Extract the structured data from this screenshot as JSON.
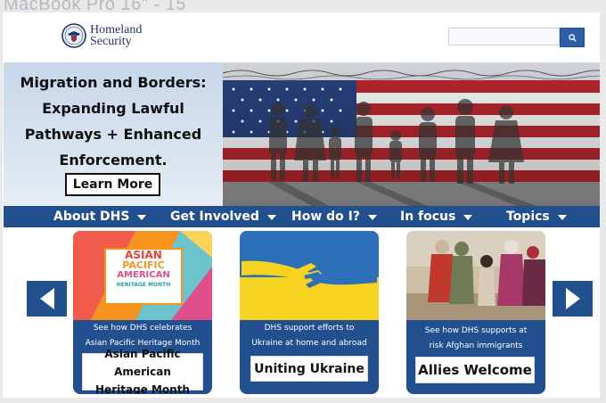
{
  "device": {
    "label": "MacBook Pro 16\"  -  15"
  },
  "header": {
    "logo_line1": "Homeland",
    "logo_line2": "Security",
    "search": {
      "placeholder": ""
    }
  },
  "hero": {
    "title_lines": [
      "Migration and Borders:",
      "Expanding Lawful",
      "Pathways + Enhanced",
      "Enforcement."
    ],
    "button_label": "Learn More"
  },
  "nav": {
    "items": [
      {
        "label": "About DHS"
      },
      {
        "label": "Get Involved"
      },
      {
        "label": "How do I?"
      },
      {
        "label": "In focus"
      },
      {
        "label": "Topics"
      }
    ]
  },
  "carousel": {
    "cards": [
      {
        "image_text": [
          "ASIAN",
          "PACIFIC",
          "AMERICAN",
          "HERITAGE MONTH"
        ],
        "desc_lines": [
          "See how DHS celebrates",
          "Asian Pacific Heritage Month"
        ],
        "button_lines": [
          "Asian Pacific American",
          "Heritage Month"
        ]
      },
      {
        "desc_lines": [
          "DHS support efforts to",
          "Ukraine at home and abroad"
        ],
        "button_lines": [
          "Uniting Ukraine"
        ]
      },
      {
        "desc_lines": [
          "See how DHS supports at",
          "risk Afghan immigrants"
        ],
        "button_lines": [
          "Allies Welcome"
        ]
      }
    ]
  },
  "colors": {
    "brand_navy": "#22508f",
    "logo_text": "#1f3366",
    "search_button": "#2d5ea7",
    "ukraine_blue": "#2d6fb8",
    "ukraine_yellow": "#f5d320"
  }
}
